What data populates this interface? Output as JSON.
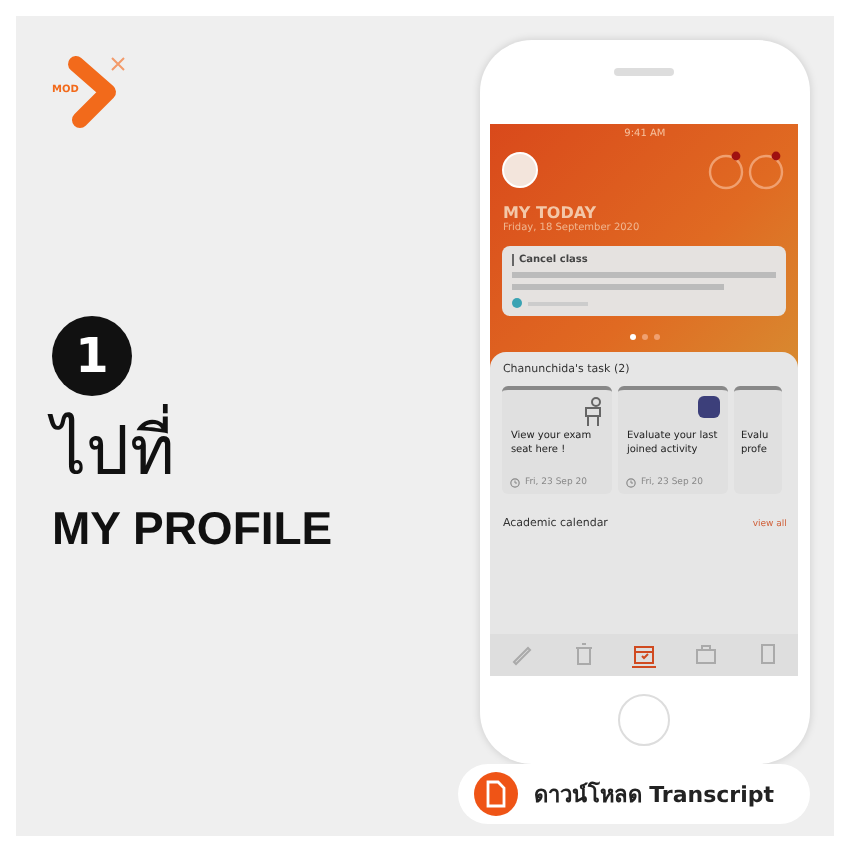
{
  "brand": {
    "logo_text": "MOD"
  },
  "step": {
    "number": "1",
    "title": "ไปที่",
    "subtitle": "MY PROFILE"
  },
  "phone": {
    "status_time": "9:41 AM",
    "header": {
      "title": "MY TODAY",
      "date": "Friday, 18 September 2020"
    },
    "announcement": {
      "title": "Cancel class"
    },
    "carousel_dots": [
      {
        "selected": true
      },
      {
        "selected": false
      },
      {
        "selected": false
      }
    ],
    "tasks": {
      "title": "Chanunchida's task (2)",
      "cards": [
        {
          "kind": "exam",
          "title": "View your exam seat here !",
          "date": "Fri, 23 Sep 20"
        },
        {
          "kind": "activity",
          "title": "Evaluate your last joined activity",
          "date": "Fri, 23 Sep 20"
        },
        {
          "kind": "plain",
          "title": "Evalu\nprofe"
        }
      ]
    },
    "calendar": {
      "title": "Academic calendar",
      "link": "view all"
    },
    "tabbar": [
      {
        "kind": "pen",
        "selected": false
      },
      {
        "kind": "bin",
        "selected": false
      },
      {
        "kind": "calendar",
        "selected": true
      },
      {
        "kind": "bag",
        "selected": false
      },
      {
        "kind": "doc",
        "selected": false
      }
    ]
  },
  "download_button": {
    "label": "ดาวน์โหลด Transcript"
  }
}
